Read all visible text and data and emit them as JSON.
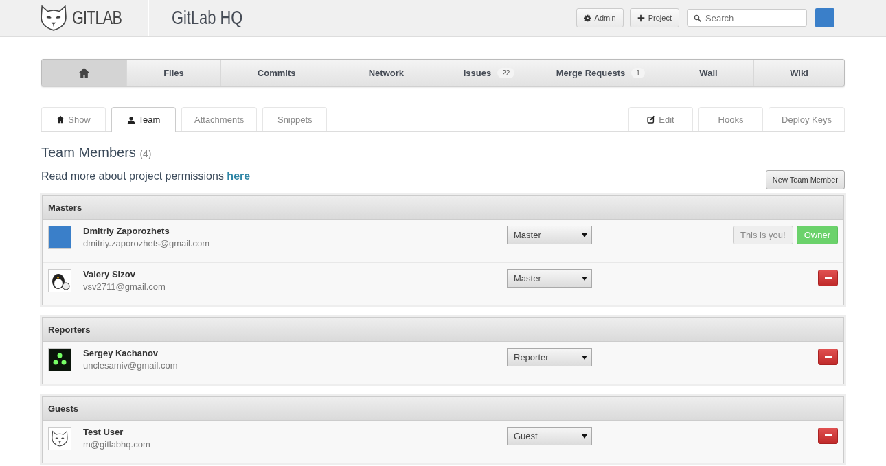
{
  "header": {
    "logo_text": "GITLAB",
    "project_title": "GitLab HQ",
    "buttons": [
      {
        "label": "Admin",
        "kind": "admin"
      },
      {
        "label": "Project",
        "kind": "new_project"
      }
    ],
    "search": {
      "placeholder": "Search"
    }
  },
  "nav": [
    {
      "kind": "home",
      "selected": true
    },
    {
      "kind": "link",
      "label": "Files",
      "selected": false
    },
    {
      "kind": "link",
      "label": "Commits",
      "selected": false
    },
    {
      "kind": "link",
      "label": "Network",
      "selected": false
    },
    {
      "kind": "link",
      "label": "Issues",
      "count": "22",
      "selected": false
    },
    {
      "kind": "link",
      "label": "Merge Requests",
      "count": "1",
      "selected": false
    },
    {
      "kind": "link",
      "label": "Wall",
      "selected": false
    },
    {
      "kind": "link",
      "label": "Wiki",
      "selected": false
    }
  ],
  "tabs_left": [
    {
      "label": "Show",
      "kind": "home",
      "selected": false
    },
    {
      "label": "Team",
      "kind": "team",
      "selected": true
    },
    {
      "label": "Attachments",
      "selected": false
    },
    {
      "label": "Snippets",
      "selected": false
    }
  ],
  "tabs_right": [
    {
      "label": "Edit",
      "kind": "edit",
      "selected": false
    },
    {
      "label": "Hooks",
      "selected": false
    },
    {
      "label": "Deploy Keys",
      "selected": false
    }
  ],
  "heading": {
    "title": "Team Members",
    "count": "(4)"
  },
  "permissions_note": {
    "text": "Read more about project permissions",
    "link": "here"
  },
  "new_member_button": "New Team Member",
  "groups": [
    {
      "title": "Masters",
      "members": [
        {
          "name": "Dmitriy Zaporozhets",
          "email": "dmitriy.zaporozhets@gmail.com",
          "kind": "photo",
          "role": "Master",
          "badges": [
            {
              "label": "This is you!",
              "kind": "muted"
            },
            {
              "label": "Owner",
              "kind": "success"
            }
          ],
          "removable": false
        },
        {
          "name": "Valery Sizov",
          "email": "vsv2711@gmail.com",
          "kind": "penguin",
          "role": "Master",
          "removable": true
        }
      ]
    },
    {
      "title": "Reporters",
      "members": [
        {
          "name": "Sergey Kachanov",
          "email": "unclesamiv@gmail.com",
          "kind": "dots",
          "role": "Reporter",
          "removable": true
        }
      ]
    },
    {
      "title": "Guests",
      "members": [
        {
          "name": "Test User",
          "email": "m@gitlabhq.com",
          "kind": "cat",
          "role": "Guest",
          "removable": true
        }
      ]
    }
  ]
}
